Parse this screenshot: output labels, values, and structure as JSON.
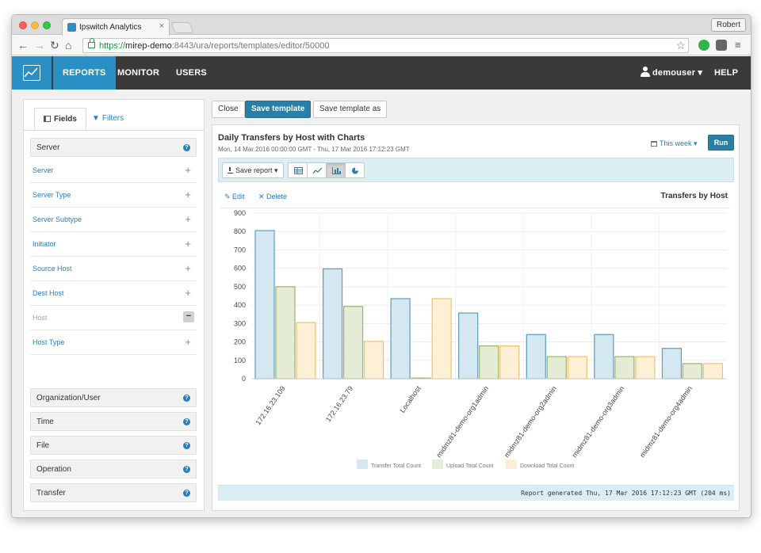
{
  "browser": {
    "tab_title": "Ipswitch Analytics",
    "tab_close": "×",
    "profile_name": "Robert",
    "url_scheme": "https://",
    "url_host": "mirep-demo",
    "url_rest": ":8443/ura/reports/templates/editor/50000"
  },
  "appbar": {
    "nav": [
      "REPORTS",
      "MONITOR",
      "USERS"
    ],
    "user": "demouser ▾",
    "help": "HELP ▾"
  },
  "left_panel": {
    "tabs": [
      "Fields",
      "Filters"
    ],
    "server_section": "Server",
    "server_items": [
      {
        "label": "Server",
        "state": "add"
      },
      {
        "label": "Server Type",
        "state": "add"
      },
      {
        "label": "Server Subtype",
        "state": "add"
      },
      {
        "label": "Initiator",
        "state": "add"
      },
      {
        "label": "Source Host",
        "state": "add"
      },
      {
        "label": "Dest Host",
        "state": "add"
      },
      {
        "label": "Host",
        "state": "selected"
      },
      {
        "label": "Host Type",
        "state": "add"
      }
    ],
    "sections": [
      "Organization/User",
      "Time",
      "File",
      "Operation",
      "Transfer"
    ]
  },
  "actions": {
    "close": "Close",
    "save_template": "Save template",
    "save_template_as": "Save template as"
  },
  "report": {
    "title": "Daily Transfers by Host with Charts",
    "subtitle": "Mon, 14 Mar 2016 00:00:00 GMT - Thu, 17 Mar 2016 17:12:23 GMT",
    "range": "This week ▾",
    "run": "Run",
    "save_report": "Save report ▾",
    "edit": "Edit",
    "delete": "Delete",
    "footer": "Report generated Thu, 17 Mar 2016 17:12:23 GMT (204 ms)"
  },
  "chart_data": {
    "type": "bar",
    "title": "Transfers by Host",
    "categories": [
      "172.16.23.109",
      "172.16.23.79",
      "Localhost",
      "midmz81-demo-org1admin",
      "midmz81-demo-org2admin",
      "midmz81-demo-org3admin",
      "midmz81-demo-org4admin"
    ],
    "series": [
      {
        "name": "Transfer Total Count",
        "values": [
          805,
          597,
          435,
          357,
          240,
          240,
          165
        ],
        "color": "#d4e8f1",
        "stroke": "#5b9cc2"
      },
      {
        "name": "Upload Total Count",
        "values": [
          500,
          393,
          0,
          178,
          120,
          120,
          82
        ],
        "color": "#e4ecd6",
        "stroke": "#9cb06a"
      },
      {
        "name": "Download Total Count",
        "values": [
          305,
          203,
          435,
          178,
          120,
          120,
          82
        ],
        "color": "#fdf0d6",
        "stroke": "#f2c16a"
      }
    ],
    "ylim": [
      0,
      900
    ],
    "yticks": [
      0,
      100,
      200,
      300,
      400,
      500,
      600,
      700,
      800,
      900
    ],
    "grid": true,
    "legend": "bottom"
  }
}
